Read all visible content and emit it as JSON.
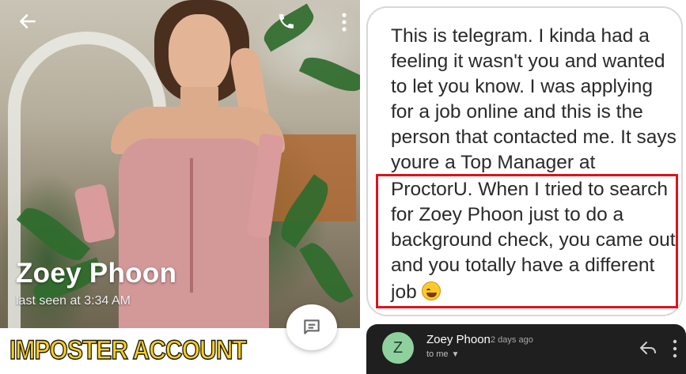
{
  "profile": {
    "name": "Zoey Phoon",
    "status": "last seen at 3:34 AM",
    "icons": {
      "back": "back-arrow-icon",
      "call": "phone-icon",
      "more": "more-vert-icon",
      "message": "message-icon"
    }
  },
  "caption": "IMPOSTER ACCOUNT",
  "message": {
    "lines": [
      "This is telegram. I kinda had a",
      "feeling it wasn't you and wanted",
      "to let you know. I was applying",
      "for a job online and this is the",
      "person that contacted me. It says",
      "youre a Top Manager at",
      "ProctorU. When I tried to search",
      "for Zoey Phoon just to do a",
      "background check, you came out",
      "and you totally have a different",
      "job"
    ],
    "emoji": "grinning-sweat-emoji",
    "highlight_color": "#e0121c"
  },
  "email": {
    "avatar_letter": "Z",
    "sender": "Zoey Phoon",
    "time": "2 days ago",
    "recipient": "to me",
    "icons": {
      "reply": "reply-icon",
      "more": "more-vert-icon"
    },
    "avatar_color": "#8fd19e"
  }
}
